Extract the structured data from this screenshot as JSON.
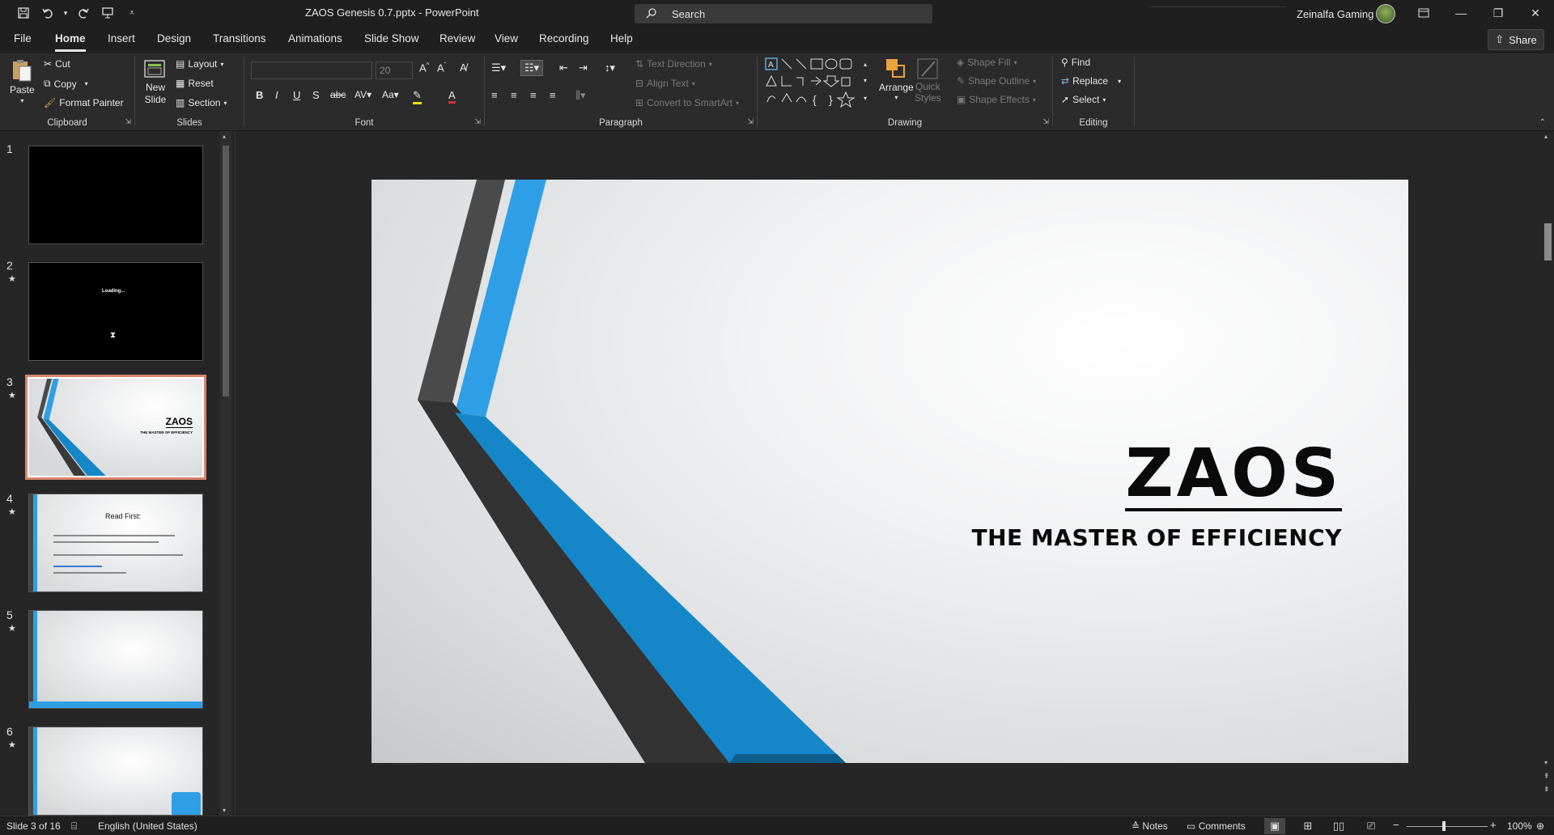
{
  "titlebar": {
    "doc_title": "ZAOS Genesis 0.7.pptx  -  PowerPoint",
    "search_placeholder": "Search",
    "user_name": "Zeinalfa Gaming"
  },
  "tabs": [
    "File",
    "Home",
    "Insert",
    "Design",
    "Transitions",
    "Animations",
    "Slide Show",
    "Review",
    "View",
    "Recording",
    "Help"
  ],
  "active_tab": "Home",
  "share_label": "Share",
  "ribbon": {
    "clipboard": {
      "label": "Clipboard",
      "paste": "Paste",
      "cut": "Cut",
      "copy": "Copy",
      "format_painter": "Format Painter"
    },
    "slides": {
      "label": "Slides",
      "new_slide_1": "New",
      "new_slide_2": "Slide",
      "layout": "Layout",
      "reset": "Reset",
      "section": "Section"
    },
    "font": {
      "label": "Font",
      "font_name": "",
      "font_size": "20"
    },
    "paragraph": {
      "label": "Paragraph",
      "text_direction": "Text Direction",
      "align_text": "Align Text",
      "convert_smartart": "Convert to SmartArt"
    },
    "drawing": {
      "label": "Drawing",
      "arrange": "Arrange",
      "quick_styles_1": "Quick",
      "quick_styles_2": "Styles",
      "shape_fill": "Shape Fill",
      "shape_outline": "Shape Outline",
      "shape_effects": "Shape Effects"
    },
    "editing": {
      "label": "Editing",
      "find": "Find",
      "replace": "Replace",
      "select": "Select"
    }
  },
  "thumbnails": [
    {
      "num": "1",
      "star": "",
      "caption": ""
    },
    {
      "num": "2",
      "star": "★",
      "caption": "Loading..."
    },
    {
      "num": "3",
      "star": "★",
      "caption": "ZAOS",
      "sub": "THE MASTER OF EFFICIENCY"
    },
    {
      "num": "4",
      "star": "★",
      "caption": "Read First:"
    },
    {
      "num": "5",
      "star": "★",
      "caption": ""
    },
    {
      "num": "6",
      "star": "★",
      "caption": ""
    }
  ],
  "slide": {
    "title": "ZAOS",
    "subtitle": "THE MASTER OF EFFICIENCY",
    "colors": {
      "blue": "#2e9fe6",
      "dark_blue": "#1587c9",
      "gray": "#4a4a4a",
      "dark": "#333333"
    }
  },
  "status": {
    "slide_count": "Slide 3 of 16",
    "language": "English (United States)",
    "notes": "Notes",
    "comments": "Comments",
    "zoom": "100%"
  }
}
